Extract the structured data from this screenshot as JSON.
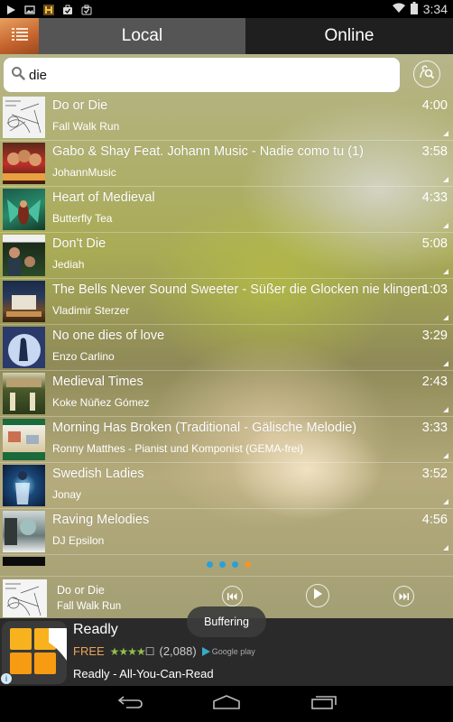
{
  "status_bar": {
    "time": "3:34",
    "left_icons": [
      "play-notification-icon",
      "image-notification-icon",
      "game-notification-icon",
      "task-notification-icon",
      "task-notification-icon"
    ],
    "right_icons": [
      "wifi-icon",
      "battery-icon"
    ]
  },
  "header": {
    "menu_icon": "list-menu-icon",
    "tabs": [
      {
        "label": "Local",
        "active": true
      },
      {
        "label": "Online",
        "active": false
      }
    ]
  },
  "search": {
    "value": "die",
    "placeholder": "",
    "online_search_icon": "online-search-icon"
  },
  "songs": [
    {
      "title": "Do or Die",
      "artist": "Fall Walk Run",
      "duration": "4:00"
    },
    {
      "title": "Gabo & Shay Feat. Johann Music - Nadie como tu (1)",
      "artist": "JohannMusic",
      "duration": "3:58"
    },
    {
      "title": "Heart of Medieval",
      "artist": "Butterfly Tea",
      "duration": "4:33"
    },
    {
      "title": "Don't Die",
      "artist": "Jediah",
      "duration": "5:08"
    },
    {
      "title": "The Bells Never Sound Sweeter - Süßer die Glocken nie klingen",
      "artist": "Vladimir Sterzer",
      "duration": "1:03"
    },
    {
      "title": "No one dies of love",
      "artist": "Enzo Carlino",
      "duration": "3:29"
    },
    {
      "title": "Medieval Times",
      "artist": "Koke Núñez Gómez",
      "duration": "2:43"
    },
    {
      "title": "Morning Has Broken (Traditional - Gälische Melodie)",
      "artist": "Ronny Matthes - Pianist und Komponist (GEMA-frei)",
      "duration": "3:33"
    },
    {
      "title": "Swedish Ladies",
      "artist": "Jonay",
      "duration": "3:52"
    },
    {
      "title": "Raving Melodies",
      "artist": "DJ Epsilon",
      "duration": "4:56"
    }
  ],
  "page_indicator": {
    "count": 4,
    "active_index": 3
  },
  "now_playing": {
    "title": "Do or Die",
    "artist": "Fall Walk Run"
  },
  "toast": "Buffering",
  "ad": {
    "title": "Readly",
    "price": "FREE",
    "rating": 4,
    "rating_max": 5,
    "reviews": "(2,088)",
    "store": "Google play",
    "description": "Readly - All-You-Can-Read"
  },
  "colors": {
    "accent_orange": "#f0962a",
    "dot_blue": "#2aa0d8",
    "tab_active_bg": "#555555",
    "tab_inactive_bg": "#1f1f1f",
    "ad_free": "#e8a35a",
    "ad_stars": "#8fc04a"
  }
}
